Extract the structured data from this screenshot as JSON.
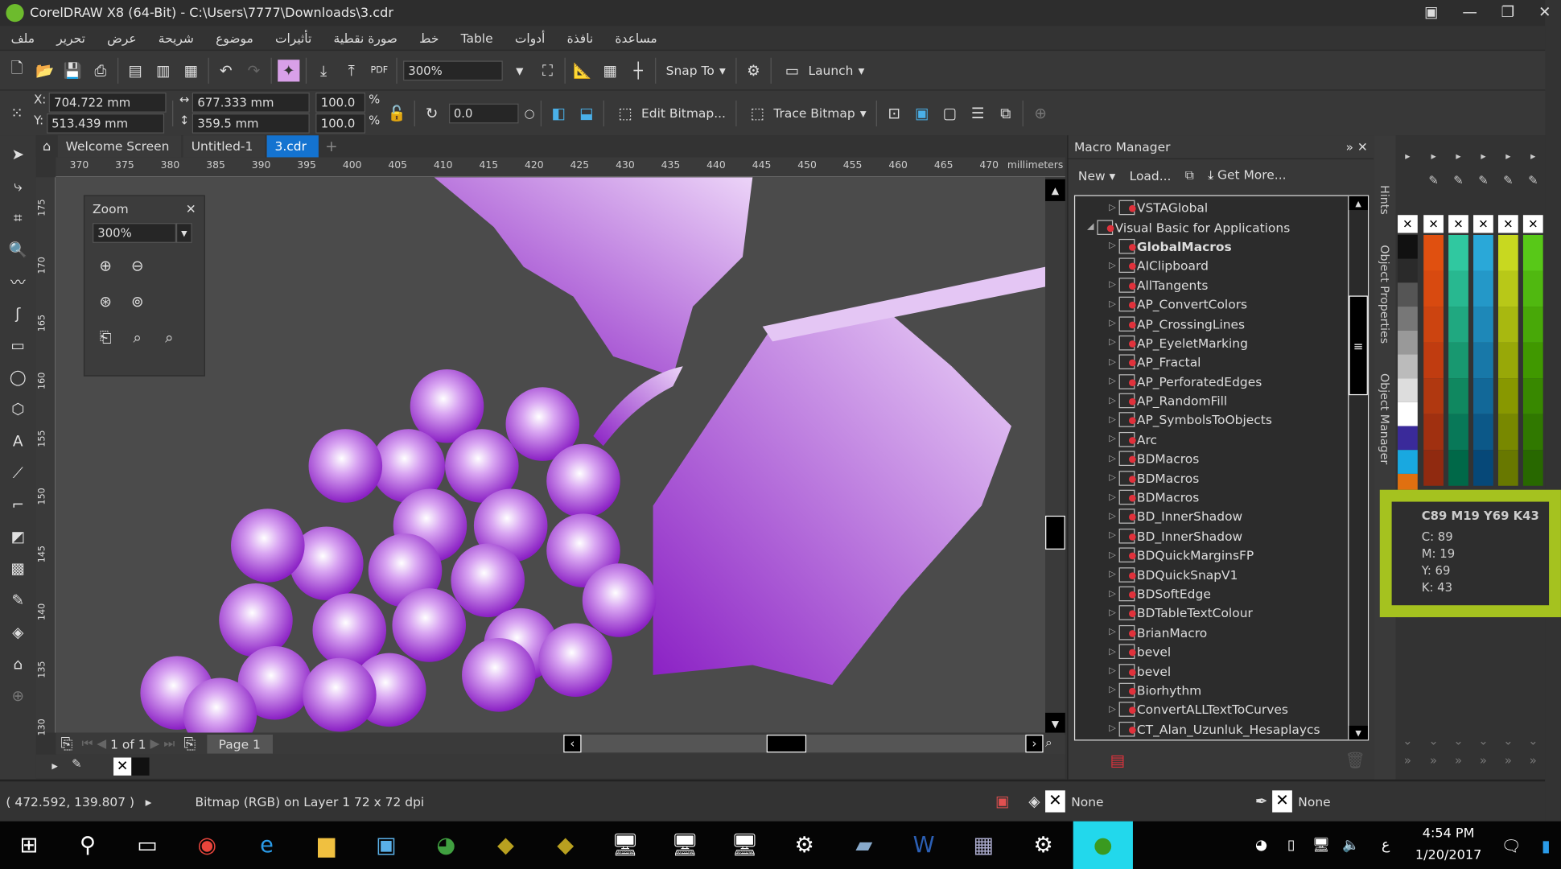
{
  "window": {
    "title": "CorelDRAW X8 (64-Bit) - C:\\Users\\7777\\Downloads\\3.cdr"
  },
  "menu": [
    "ملف",
    "تحرير",
    "عرض",
    "شريحة",
    "موضوع",
    "تأثيرات",
    "صورة نقطية",
    "خط",
    "Table",
    "أدوات",
    "نافذة",
    "مساعدة"
  ],
  "toolbar": {
    "zoom_value": "300%",
    "snap_label": "Snap To",
    "launch_label": "Launch"
  },
  "property_bar": {
    "x": "704.722 mm",
    "y": "513.439 mm",
    "width": "677.333 mm",
    "height": "359.5 mm",
    "scale_x": "100.0",
    "scale_y": "100.0",
    "percent": "%",
    "x_label": "X:",
    "y_label": "Y:",
    "angle": "0.0",
    "edit_bitmap": "Edit Bitmap...",
    "trace_bitmap": "Trace Bitmap"
  },
  "tabs": [
    {
      "label": "Welcome Screen"
    },
    {
      "label": "Untitled-1"
    },
    {
      "label": "3.cdr",
      "active": true
    }
  ],
  "ruler": {
    "ticks": [
      "370",
      "375",
      "380",
      "385",
      "390",
      "395",
      "400",
      "405",
      "410",
      "415",
      "420",
      "425",
      "430",
      "435",
      "440",
      "445",
      "450",
      "455",
      "460",
      "465",
      "470"
    ],
    "unit": "millimeters",
    "vticks": [
      "175",
      "170",
      "165",
      "160",
      "155",
      "150",
      "145",
      "140",
      "135",
      "130"
    ]
  },
  "zoom_panel": {
    "title": "Zoom",
    "value": "300%"
  },
  "page_nav": {
    "counter": "1 of 1",
    "page_tab": "Page 1"
  },
  "macro_manager": {
    "title": "Macro Manager",
    "new": "New",
    "load": "Load...",
    "get_more": "Get More...",
    "items": [
      {
        "label": "VSTAGlobal",
        "indent": 1
      },
      {
        "label": "Visual Basic for Applications",
        "indent": 0,
        "expanded": true
      },
      {
        "label": "GlobalMacros",
        "indent": 1,
        "bold": true
      },
      {
        "label": "AIClipboard",
        "indent": 1
      },
      {
        "label": "AllTangents",
        "indent": 1
      },
      {
        "label": "AP_ConvertColors",
        "indent": 1
      },
      {
        "label": "AP_CrossingLines",
        "indent": 1
      },
      {
        "label": "AP_EyeletMarking",
        "indent": 1
      },
      {
        "label": "AP_Fractal",
        "indent": 1
      },
      {
        "label": "AP_PerforatedEdges",
        "indent": 1
      },
      {
        "label": "AP_RandomFill",
        "indent": 1
      },
      {
        "label": "AP_SymbolsToObjects",
        "indent": 1
      },
      {
        "label": "Arc",
        "indent": 1
      },
      {
        "label": "BDMacros",
        "indent": 1
      },
      {
        "label": "BDMacros",
        "indent": 1
      },
      {
        "label": "BDMacros",
        "indent": 1
      },
      {
        "label": "BD_InnerShadow",
        "indent": 1
      },
      {
        "label": "BD_InnerShadow",
        "indent": 1
      },
      {
        "label": "BDQuickMarginsFP",
        "indent": 1
      },
      {
        "label": "BDQuickSnapV1",
        "indent": 1
      },
      {
        "label": "BDSoftEdge",
        "indent": 1
      },
      {
        "label": "BDTableTextColour",
        "indent": 1
      },
      {
        "label": "BrianMacro",
        "indent": 1
      },
      {
        "label": "bevel",
        "indent": 1
      },
      {
        "label": "bevel",
        "indent": 1
      },
      {
        "label": "Biorhythm",
        "indent": 1
      },
      {
        "label": "ConvertALLTextToCurves",
        "indent": 1
      },
      {
        "label": "CT_Alan_Uzunluk_Hesaplaycs",
        "indent": 1
      }
    ]
  },
  "side_tabs": [
    "Hints",
    "Object Properties",
    "Object Manager"
  ],
  "color_tooltip": {
    "title": "C89 M19 Y69 K43",
    "c": "C: 89",
    "m": "M: 19",
    "y": "Y: 69",
    "k": "K: 43",
    "highlight": "#a5c21f"
  },
  "palette_columns": [
    [
      "#111111",
      "#2a2a2a",
      "#555555",
      "#777777",
      "#999999",
      "#bbbbbb",
      "#dddddd",
      "#ffffff",
      "#3a2a9a",
      "#19a8e0",
      "#e07010",
      "#f4b0b8",
      "#7a6a5a",
      "#c0b0d8",
      "#9a90c8",
      "#7a70b8"
    ],
    [
      "#e05010",
      "#d84a10",
      "#cc4410",
      "#c03c10",
      "#b03810",
      "#a03010",
      "#902a10"
    ],
    [
      "#30c8a0",
      "#28b890",
      "#20a880",
      "#189870",
      "#108860",
      "#087858",
      "#006848"
    ],
    [
      "#2aa8d8",
      "#2498c8",
      "#1e88b8",
      "#1878a8",
      "#126898",
      "#0c5888",
      "#064878"
    ],
    [
      "#c8d820",
      "#b8c818",
      "#a8b810",
      "#98a808",
      "#889800",
      "#788800",
      "#687800"
    ],
    [
      "#58c818",
      "#50b810",
      "#48a808",
      "#409800",
      "#388800",
      "#307800",
      "#286800"
    ]
  ],
  "status": {
    "coords": "( 472.592, 139.807 )",
    "info": "Bitmap (RGB) on Layer 1 72 x 72 dpi",
    "fill": "None",
    "outline": "None"
  },
  "taskbar": {
    "time": "4:54 PM",
    "date": "1/20/2017",
    "lang": "ع"
  },
  "colors": {
    "accent": "#1473d0",
    "grape": "#9b30d0"
  }
}
